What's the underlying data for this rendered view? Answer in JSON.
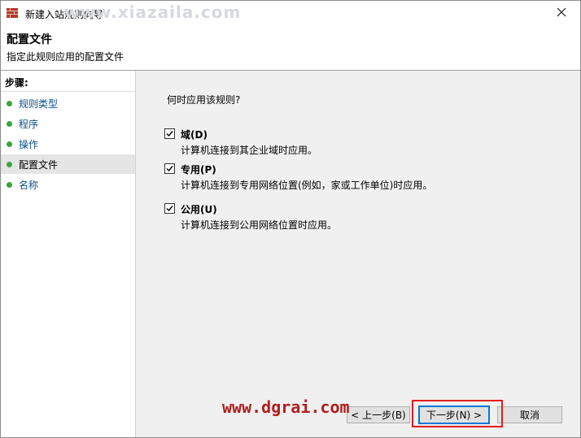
{
  "window": {
    "title": "新建入站规则向导",
    "watermark": "www.xiazaila.com"
  },
  "header": {
    "title": "配置文件",
    "subtitle": "指定此规则应用的配置文件"
  },
  "sidebar": {
    "steps_label": "步骤:",
    "items": [
      {
        "label": "规则类型",
        "active": false
      },
      {
        "label": "程序",
        "active": false
      },
      {
        "label": "操作",
        "active": false
      },
      {
        "label": "配置文件",
        "active": true
      },
      {
        "label": "名称",
        "active": false
      }
    ]
  },
  "main": {
    "question": "何时应用该规则?",
    "options": [
      {
        "label": "域(D)",
        "desc": "计算机连接到其企业域时应用。",
        "checked": true
      },
      {
        "label": "专用(P)",
        "desc": "计算机连接到专用网络位置(例如，家或工作单位)时应用。",
        "checked": true
      },
      {
        "label": "公用(U)",
        "desc": "计算机连接到公用网络位置时应用。",
        "checked": true
      }
    ]
  },
  "buttons": {
    "back": "< 上一步(B)",
    "next": "下一步(N) >",
    "cancel": "取消"
  },
  "overlay": {
    "site": "www.dgrai.com"
  },
  "colors": {
    "accent": "#0078d7",
    "step_dot": "#3aa540",
    "highlight": "#e31d1d"
  }
}
